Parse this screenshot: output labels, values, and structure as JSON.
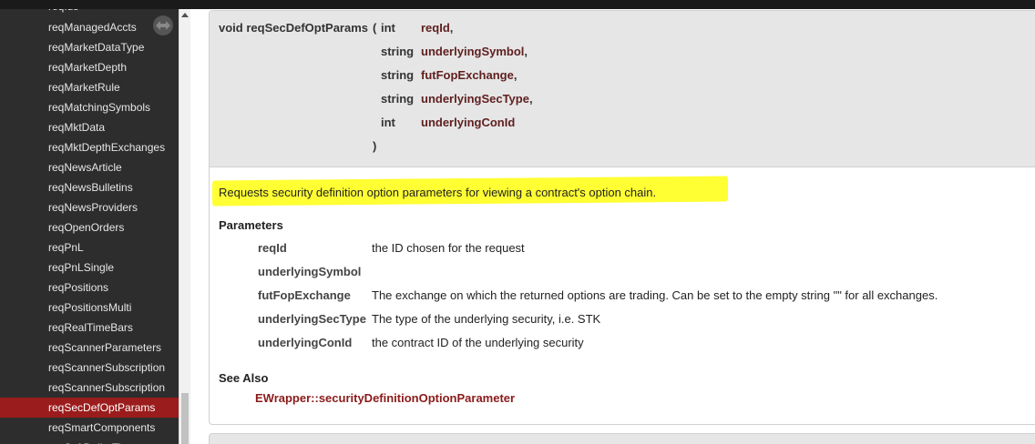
{
  "sidebar": {
    "items": [
      {
        "label": "reqIds"
      },
      {
        "label": "reqManagedAccts"
      },
      {
        "label": "reqMarketDataType"
      },
      {
        "label": "reqMarketDepth"
      },
      {
        "label": "reqMarketRule"
      },
      {
        "label": "reqMatchingSymbols"
      },
      {
        "label": "reqMktData"
      },
      {
        "label": "reqMktDepthExchanges"
      },
      {
        "label": "reqNewsArticle"
      },
      {
        "label": "reqNewsBulletins"
      },
      {
        "label": "reqNewsProviders"
      },
      {
        "label": "reqOpenOrders"
      },
      {
        "label": "reqPnL"
      },
      {
        "label": "reqPnLSingle"
      },
      {
        "label": "reqPositions"
      },
      {
        "label": "reqPositionsMulti"
      },
      {
        "label": "reqRealTimeBars"
      },
      {
        "label": "reqScannerParameters"
      },
      {
        "label": "reqScannerSubscription"
      },
      {
        "label": "reqScannerSubscription"
      },
      {
        "label": "reqSecDefOptParams",
        "active": true
      },
      {
        "label": "reqSmartComponents"
      },
      {
        "label": "reqSoftDollarTiers"
      }
    ],
    "handle_icon": "resize-arrows-icon"
  },
  "signature": {
    "return_and_name": "void reqSecDefOptParams",
    "open_paren": "(",
    "params": [
      {
        "type": "int",
        "name": "reqId",
        "sep": ","
      },
      {
        "type": "string",
        "name": "underlyingSymbol",
        "sep": ","
      },
      {
        "type": "string",
        "name": "futFopExchange",
        "sep": ","
      },
      {
        "type": "string",
        "name": "underlyingSecType",
        "sep": ","
      },
      {
        "type": "int",
        "name": "underlyingConId",
        "sep": ""
      }
    ],
    "close_paren": ")"
  },
  "description": "Requests security definition option parameters for viewing a contract's option chain.",
  "parameters": {
    "title": "Parameters",
    "items": [
      {
        "name": "reqId",
        "desc": "the ID chosen for the request"
      },
      {
        "name": "underlyingSymbol",
        "desc": ""
      },
      {
        "name": "futFopExchange",
        "desc": "The exchange on which the returned options are trading. Can be set to the empty string \"\" for all exchanges."
      },
      {
        "name": "underlyingSecType",
        "desc": "The type of the underlying security, i.e. STK"
      },
      {
        "name": "underlyingConId",
        "desc": "the contract ID of the underlying security"
      }
    ]
  },
  "see_also": {
    "title": "See Also",
    "link": "EWrapper::securityDefinitionOptionParameter"
  },
  "colors": {
    "sidebar_bg": "#2d2d2d",
    "active_item": "#9b1c1c",
    "highlight": "#ffff33",
    "param_name": "#602020",
    "link": "#8b1a1a"
  }
}
